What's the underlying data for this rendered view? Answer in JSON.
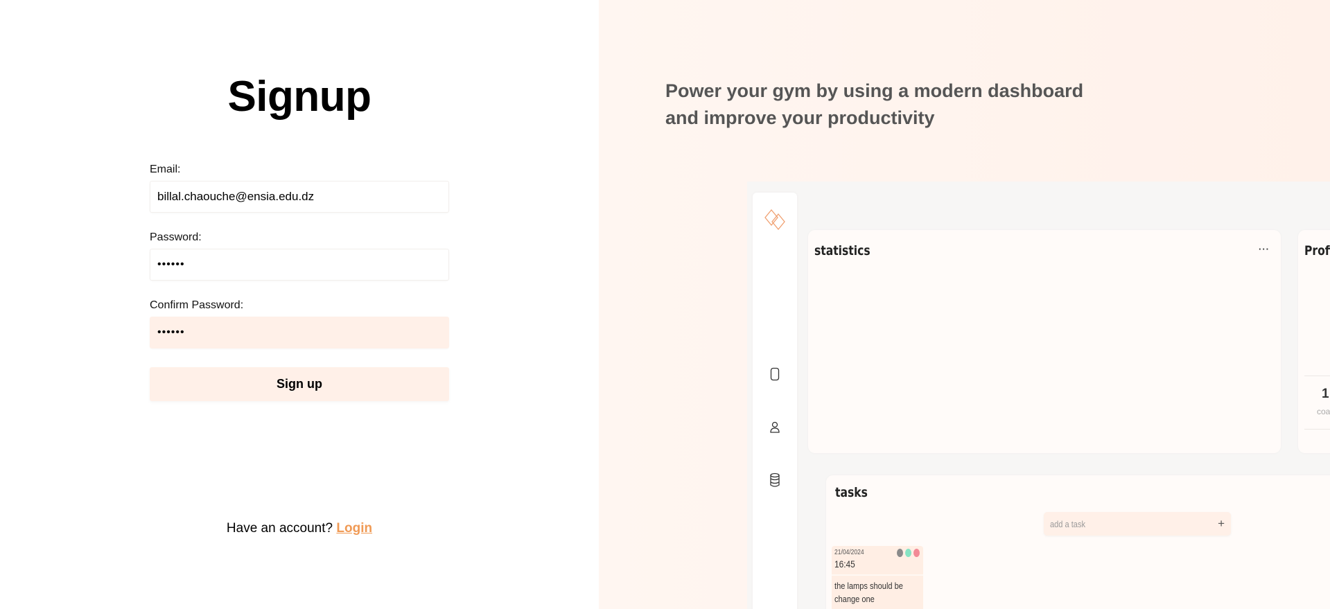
{
  "signup": {
    "title": "Signup",
    "email_label": "Email:",
    "email_value": "billal.chaouche@ensia.edu.dz",
    "password_label": "Password:",
    "password_value": "••••••",
    "confirm_label": "Confirm Password:",
    "confirm_value": "••••••",
    "submit_label": "Sign up",
    "have_account_text": "Have an account?",
    "login_link": "Login"
  },
  "promo": {
    "tagline": "Power your gym by using a modern dashboard and improve your productivity"
  },
  "dashboard": {
    "sidebar_icons": [
      "logo-icon",
      "device-icon",
      "user-icon",
      "database-icon"
    ],
    "statistics_title": "statistics",
    "statistics_menu": "···",
    "profile_title": "Profi",
    "profile_stat_value": "1",
    "profile_stat_label": "coac",
    "tasks_title": "tasks",
    "add_task_placeholder": "add a task",
    "add_task_button": "+",
    "task": {
      "date": "21/04/2024",
      "time": "16:45",
      "text": "the lamps should be change one",
      "text_line1": "the lamps should be",
      "text_line2": "change one",
      "dot_colors": [
        "#8a8a8a",
        "#86e3c3",
        "#f28a96"
      ]
    }
  },
  "colors": {
    "accent": "#f09a55",
    "soft_peach": "#fff0e8",
    "tagline": "#555555"
  }
}
